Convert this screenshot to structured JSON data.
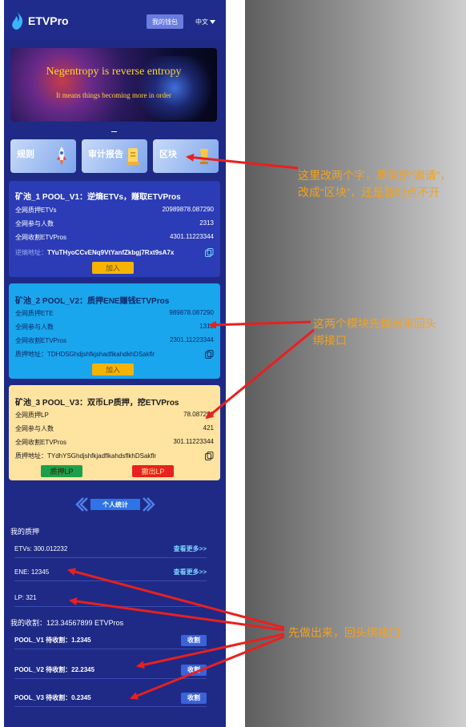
{
  "app": {
    "title": "ETVPro",
    "wallet_button": "我的钱包",
    "language": "中文"
  },
  "banner": {
    "title": "Negentropy is reverse entropy",
    "subtitle": "It means things becoming more in order"
  },
  "tiles": [
    {
      "label": "规则"
    },
    {
      "label": "审计报告"
    },
    {
      "label": "区块"
    }
  ],
  "pools": [
    {
      "title": "矿池_1  POOL_V1：逆熵ETVs，赚取ETVPros",
      "rows": [
        {
          "label": "全网质押ETVs",
          "value": "20989878.087290"
        },
        {
          "label": "全网参与人数",
          "value": "2313"
        },
        {
          "label": "全网收割ETVPros",
          "value": "4301.11223344"
        }
      ],
      "addr_label": "逆熵地址：",
      "addr": "TYuTHyoCCvENq9VtYanfZkbgj7Rxt9sA7x",
      "join": "加入"
    },
    {
      "title": "矿池_2  POOL_V2：质押ENE赚钱ETVPros",
      "rows": [
        {
          "label": "全网质押ETE",
          "value": "989878.087290"
        },
        {
          "label": "全网参与人数",
          "value": "1313"
        },
        {
          "label": "全网收割ETVPros",
          "value": "2301.11223344"
        }
      ],
      "addr_label": "质押地址：",
      "addr": "TDHDSGhdjshfkjshadfikahdkhDSakflr",
      "join": "加入"
    },
    {
      "title": "矿池_3  POOL_V3：双币LP质押，挖ETVPros",
      "rows": [
        {
          "label": "全网质押LP",
          "value": "78.087290"
        },
        {
          "label": "全网参与人数",
          "value": "421"
        },
        {
          "label": "全网收割ETVPros",
          "value": "301.11223344"
        }
      ],
      "addr_label": "质押地址：",
      "addr": "TYdhYSGhdjshfkjadflkahdsflkhDSakflr",
      "stake": "质押LP",
      "withdraw": "撤出LP"
    }
  ],
  "stats": {
    "heading": "个人统计",
    "my_stake_label": "我的质押",
    "stakes": [
      {
        "text": "ETVs: 300.012232",
        "more": "查看更多>>"
      },
      {
        "text": "ENE: 12345",
        "more": "查看更多>>"
      },
      {
        "text": "LP: 321"
      }
    ],
    "my_harvest_label": "我的收割：123.34567899 ETVPros",
    "harvests": [
      {
        "text": "POOL_V1 待收割：1.2345",
        "button": "收割"
      },
      {
        "text": "POOL_V2 待收割：22.2345",
        "button": "收割"
      },
      {
        "text": "POOL_V3 待收割：0.2345",
        "button": "收割"
      }
    ]
  },
  "annotations": [
    "这里改两个字，原来是“邀请”，改成“区块”，还是暂时点不开",
    "这两个模块先做出来回头绑接口",
    "先做出来，回头绑接口"
  ],
  "colors": {
    "phone_bg": "#1e2a86",
    "pool1": "#2b3cb6",
    "pool2": "#1aa6ec",
    "pool3": "#ffe3a0",
    "join_btn": "#f5b400",
    "stake_btn": "#1aa04a",
    "withdraw_btn": "#e8201f",
    "annotation": "#f5a11b",
    "arrow": "#e8201f"
  }
}
